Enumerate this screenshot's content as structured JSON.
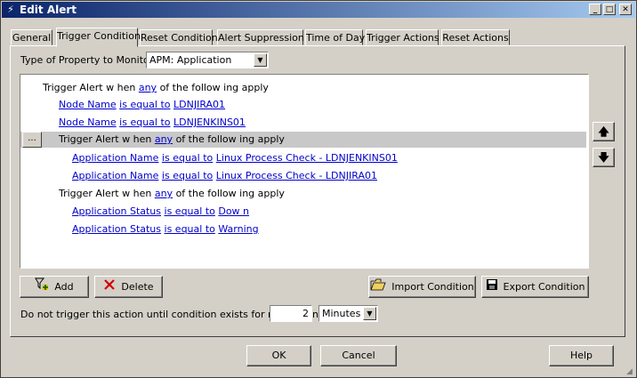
{
  "window": {
    "title": "Edit Alert",
    "icon": "app-alert-icon"
  },
  "tabs": [
    "General",
    "Trigger Condition",
    "Reset Condition",
    "Alert Suppression",
    "Time of Day",
    "Trigger Actions",
    "Reset Actions"
  ],
  "active_tab": "Trigger Condition",
  "property": {
    "label": "Type of Property to Monitor:",
    "value": "APM: Application"
  },
  "tree": {
    "root": {
      "prefix": "Trigger Alert w hen",
      "link": "any",
      "suffix": "of the follow ing apply"
    },
    "node1": {
      "field": "Node Name",
      "op": "is equal to",
      "value": "LDNJIRA01"
    },
    "node2": {
      "field": "Node Name",
      "op": "is equal to",
      "value": "LDNJENKINS01"
    },
    "group1": {
      "ellipsis": "...",
      "prefix": "Trigger Alert w hen",
      "link": "any",
      "suffix": "of the follow ing apply"
    },
    "app1": {
      "field": "Application Name",
      "op": "is equal to",
      "value": "Linux Process Check - LDNJENKINS01"
    },
    "app2": {
      "field": "Application Name",
      "op": "is equal to",
      "value": "Linux Process Check - LDNJIRA01"
    },
    "group2": {
      "prefix": "Trigger Alert w hen",
      "link": "any",
      "suffix": "of the follow ing apply"
    },
    "status1": {
      "field": "Application Status",
      "op": "is equal to",
      "value": "Dow n"
    },
    "status2": {
      "field": "Application Status",
      "op": "is equal to",
      "value": "Warning"
    }
  },
  "buttons": {
    "add": "Add",
    "delete": "Delete",
    "import": "Import Condition",
    "export": "Export Condition",
    "ok": "OK",
    "cancel": "Cancel",
    "help": "Help"
  },
  "delay": {
    "label": "Do not trigger this action until condition exists for more than",
    "value": "2",
    "unit": "Minutes"
  },
  "colors": {
    "title_start": "#0a246a",
    "title_end": "#a6caf0",
    "link": "#0000cc",
    "selected_row": "#c8c8c8"
  }
}
